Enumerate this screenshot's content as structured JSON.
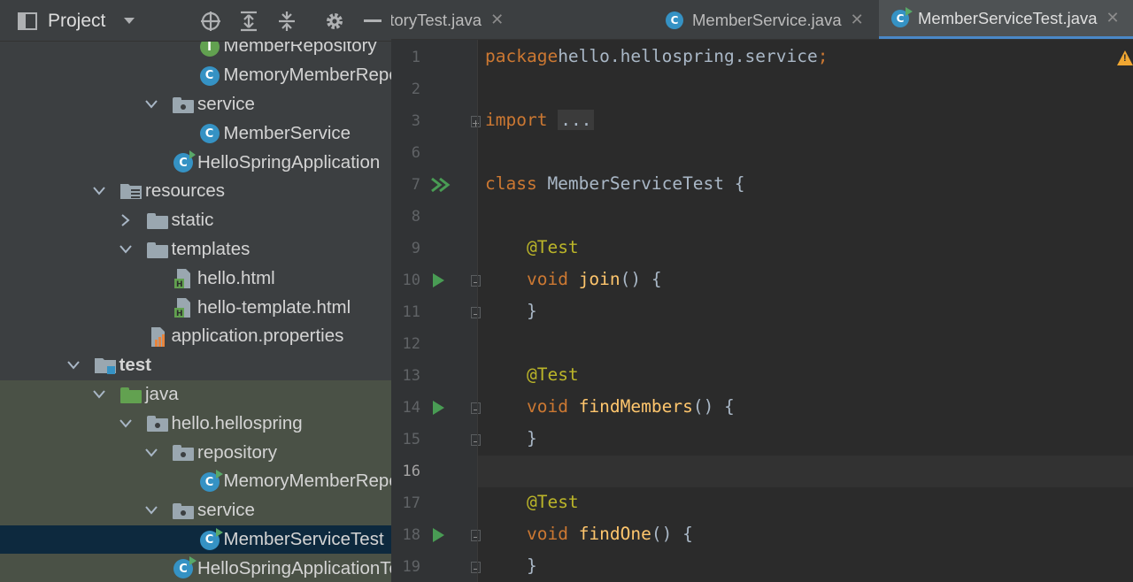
{
  "project_panel": {
    "title": "Project",
    "tree": [
      {
        "label": "MemberRepository",
        "icon": "interface-icon",
        "depth": 3,
        "arrow": "",
        "state": ""
      },
      {
        "label": "MemoryMemberRepository",
        "icon": "class-icon",
        "depth": 3,
        "arrow": "",
        "state": ""
      },
      {
        "label": "service",
        "icon": "package-icon",
        "depth": 2,
        "arrow": "expanded",
        "state": ""
      },
      {
        "label": "MemberService",
        "icon": "class-icon",
        "depth": 3,
        "arrow": "",
        "state": ""
      },
      {
        "label": "HelloSpringApplication",
        "icon": "spring-class-icon",
        "depth": 2,
        "arrow": "",
        "state": ""
      },
      {
        "label": "resources",
        "icon": "resources-folder-icon",
        "depth": 0,
        "arrow": "expanded",
        "state": ""
      },
      {
        "label": "static",
        "icon": "folder-icon",
        "depth": 1,
        "arrow": "collapsed",
        "state": ""
      },
      {
        "label": "templates",
        "icon": "folder-icon",
        "depth": 1,
        "arrow": "expanded",
        "state": ""
      },
      {
        "label": "hello.html",
        "icon": "html-file-icon",
        "depth": 2,
        "arrow": "",
        "state": ""
      },
      {
        "label": "hello-template.html",
        "icon": "html-file-icon",
        "depth": 2,
        "arrow": "",
        "state": ""
      },
      {
        "label": "application.properties",
        "icon": "properties-file-icon",
        "depth": 1,
        "arrow": "",
        "state": ""
      },
      {
        "label": "test",
        "icon": "test-folder-icon",
        "depth": -1,
        "arrow": "expanded",
        "state": "",
        "bold": true
      },
      {
        "label": "java",
        "icon": "test-source-folder-icon",
        "depth": 0,
        "arrow": "expanded",
        "state": "test"
      },
      {
        "label": "hello.hellospring",
        "icon": "package-icon",
        "depth": 1,
        "arrow": "expanded",
        "state": "test"
      },
      {
        "label": "repository",
        "icon": "package-icon",
        "depth": 2,
        "arrow": "expanded",
        "state": "test"
      },
      {
        "label": "MemoryMemberRepositoryTest",
        "icon": "test-class-icon",
        "depth": 3,
        "arrow": "",
        "state": "test"
      },
      {
        "label": "service",
        "icon": "package-icon",
        "depth": 2,
        "arrow": "expanded",
        "state": "test"
      },
      {
        "label": "MemberServiceTest",
        "icon": "test-class-icon",
        "depth": 3,
        "arrow": "",
        "state": "selected"
      },
      {
        "label": "HelloSpringApplicationTests",
        "icon": "test-class-icon",
        "depth": 2,
        "arrow": "",
        "state": "test"
      }
    ]
  },
  "editor": {
    "tabs": [
      {
        "label": "MemoryMemberRepositoryTest.java",
        "active": false
      },
      {
        "label": "MemberService.java",
        "active": false
      },
      {
        "label": "MemberServiceTest.java",
        "active": true
      }
    ],
    "lines": [
      {
        "n": "1",
        "tokens": [
          [
            "kw",
            "package"
          ],
          [
            "",
            "hello.hellospring.service"
          ],
          [
            "kw",
            ";"
          ]
        ]
      },
      {
        "n": "2",
        "tokens": []
      },
      {
        "n": "3",
        "tokens": [
          [
            "kw",
            "import"
          ],
          [
            "",
            " "
          ],
          [
            "fold",
            "..."
          ]
        ],
        "fold": "plus"
      },
      {
        "n": "6",
        "tokens": []
      },
      {
        "n": "7",
        "tokens": [
          [
            "kw",
            "class"
          ],
          [
            "",
            " MemberServiceTest {"
          ]
        ],
        "run": "double"
      },
      {
        "n": "8",
        "tokens": []
      },
      {
        "n": "9",
        "tokens": [
          [
            "",
            "    "
          ],
          [
            "ann",
            "@Test"
          ]
        ]
      },
      {
        "n": "10",
        "tokens": [
          [
            "",
            "    "
          ],
          [
            "kw",
            "void"
          ],
          [
            "",
            " "
          ],
          [
            "fn",
            "join"
          ],
          [
            "",
            "() {"
          ]
        ],
        "run": "single",
        "fold": "open"
      },
      {
        "n": "11",
        "tokens": [
          [
            "",
            "    }"
          ]
        ],
        "fold": "close"
      },
      {
        "n": "12",
        "tokens": []
      },
      {
        "n": "13",
        "tokens": [
          [
            "",
            "    "
          ],
          [
            "ann",
            "@Test"
          ]
        ]
      },
      {
        "n": "14",
        "tokens": [
          [
            "",
            "    "
          ],
          [
            "kw",
            "void"
          ],
          [
            "",
            " "
          ],
          [
            "fn",
            "findMembers"
          ],
          [
            "",
            "() {"
          ]
        ],
        "run": "single",
        "fold": "open"
      },
      {
        "n": "15",
        "tokens": [
          [
            "",
            "    }"
          ]
        ],
        "fold": "close"
      },
      {
        "n": "16",
        "tokens": [],
        "current": true
      },
      {
        "n": "17",
        "tokens": [
          [
            "",
            "    "
          ],
          [
            "ann",
            "@Test"
          ]
        ]
      },
      {
        "n": "18",
        "tokens": [
          [
            "",
            "    "
          ],
          [
            "kw",
            "void"
          ],
          [
            "",
            " "
          ],
          [
            "fn",
            "findOne"
          ],
          [
            "",
            "() {"
          ]
        ],
        "run": "single",
        "fold": "open"
      },
      {
        "n": "19",
        "tokens": [
          [
            "",
            "    }"
          ]
        ],
        "fold": "close"
      }
    ]
  },
  "colors": {
    "keyword": "#cc7832",
    "annotation": "#bbb529",
    "function": "#ffc66d",
    "accent": "#4a88c7",
    "selection": "#0d293e",
    "test_scope": "#4a5146"
  }
}
